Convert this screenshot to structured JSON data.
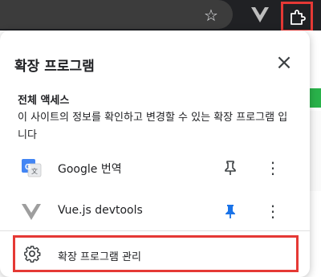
{
  "toolbar": {
    "star_icon": "star-icon",
    "vue_icon": "vue-icon",
    "extensions_icon": "puzzle-icon"
  },
  "popup": {
    "title": "확장 프로그램",
    "close_icon": "close-icon",
    "section_title": "전체 액세스",
    "description": "이 사이트의 정보를 확인하고 변경할 수 있는 확장 프로그램 입니다",
    "extensions": [
      {
        "name": "Google 번역",
        "icon": "google-translate-icon",
        "pinned": false
      },
      {
        "name": "Vue.js devtools",
        "icon": "vue-icon",
        "pinned": true
      }
    ],
    "manage_label": "확장 프로그램 관리"
  },
  "colors": {
    "highlight_red": "#e53935",
    "pin_blue": "#1a73e8",
    "topbar_dark": "#202124"
  }
}
